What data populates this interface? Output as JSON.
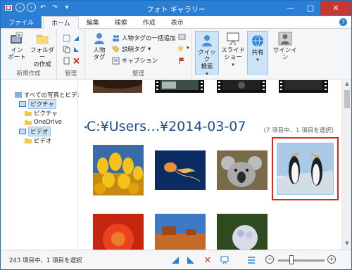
{
  "window": {
    "title": "フォト ギャラリー",
    "close_label": "✕",
    "maximize_label": "□",
    "minimize_label": "—"
  },
  "tabs": [
    {
      "label": "ファイル"
    },
    {
      "label": "ホーム"
    },
    {
      "label": "編集"
    },
    {
      "label": "検索"
    },
    {
      "label": "作成"
    },
    {
      "label": "表示"
    }
  ],
  "ribbon": {
    "import_label": "インポート",
    "import_label_line1": "イン",
    "import_label_line2": "ポート",
    "folder_label_line1": "フォルダー",
    "folder_label_line2": "の作成",
    "group_new": "新規作成",
    "group_manage": "管理",
    "person_tag_line1": "人物",
    "person_tag_line2": "タグ",
    "bulk_person_tag": "人物タグの一括追加",
    "description_tag": "説明タグ",
    "caption": "キャプション",
    "group_organize": "整理",
    "quick_find_line1": "クイック",
    "quick_find_line2": "検索",
    "slideshow_line1": "スライド",
    "slideshow_line2": "ショー",
    "share": "共有",
    "signin": "サインイン"
  },
  "sidebar": {
    "items": [
      {
        "label": "すべての写真とビデオ"
      },
      {
        "label": "ピクチャ"
      },
      {
        "label": "ピクチャ"
      },
      {
        "label": "OneDrive"
      },
      {
        "label": "ビデオ"
      },
      {
        "label": "ビデオ"
      }
    ]
  },
  "main": {
    "group_title": "C:¥Users…¥2014-03-07",
    "group_count": "(7 項目中、1 項目を選択)"
  },
  "status": {
    "text": "243 項目中、1 項目を選択"
  },
  "colors": {
    "accent": "#2a7fd4",
    "selection_highlight": "#e0251b",
    "group_title": "#1d4e8a"
  }
}
